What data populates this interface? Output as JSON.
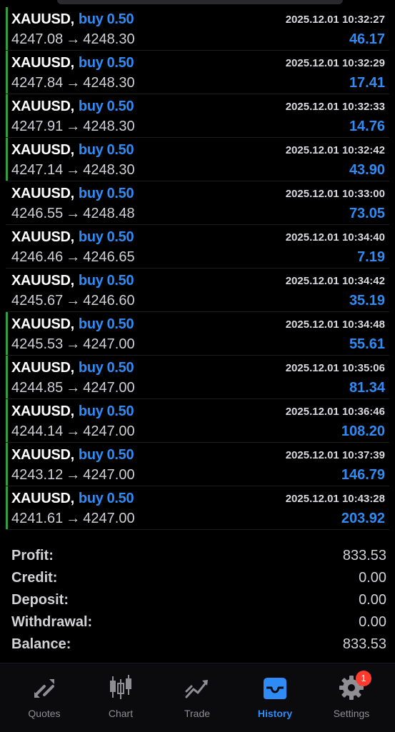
{
  "trades": [
    {
      "symbol": "XAUUSD",
      "side": "buy",
      "lots": "0.50",
      "time": "2025.12.01 10:32:27",
      "open": "4247.08",
      "close": "4248.30",
      "profit": "46.17",
      "marked": true
    },
    {
      "symbol": "XAUUSD",
      "side": "buy",
      "lots": "0.50",
      "time": "2025.12.01 10:32:29",
      "open": "4247.84",
      "close": "4248.30",
      "profit": "17.41",
      "marked": true
    },
    {
      "symbol": "XAUUSD",
      "side": "buy",
      "lots": "0.50",
      "time": "2025.12.01 10:32:33",
      "open": "4247.91",
      "close": "4248.30",
      "profit": "14.76",
      "marked": true
    },
    {
      "symbol": "XAUUSD",
      "side": "buy",
      "lots": "0.50",
      "time": "2025.12.01 10:32:42",
      "open": "4247.14",
      "close": "4248.30",
      "profit": "43.90",
      "marked": true
    },
    {
      "symbol": "XAUUSD",
      "side": "buy",
      "lots": "0.50",
      "time": "2025.12.01 10:33:00",
      "open": "4246.55",
      "close": "4248.48",
      "profit": "73.05",
      "marked": false
    },
    {
      "symbol": "XAUUSD",
      "side": "buy",
      "lots": "0.50",
      "time": "2025.12.01 10:34:40",
      "open": "4246.46",
      "close": "4246.65",
      "profit": "7.19",
      "marked": false
    },
    {
      "symbol": "XAUUSD",
      "side": "buy",
      "lots": "0.50",
      "time": "2025.12.01 10:34:42",
      "open": "4245.67",
      "close": "4246.60",
      "profit": "35.19",
      "marked": false
    },
    {
      "symbol": "XAUUSD",
      "side": "buy",
      "lots": "0.50",
      "time": "2025.12.01 10:34:48",
      "open": "4245.53",
      "close": "4247.00",
      "profit": "55.61",
      "marked": true
    },
    {
      "symbol": "XAUUSD",
      "side": "buy",
      "lots": "0.50",
      "time": "2025.12.01 10:35:06",
      "open": "4244.85",
      "close": "4247.00",
      "profit": "81.34",
      "marked": true
    },
    {
      "symbol": "XAUUSD",
      "side": "buy",
      "lots": "0.50",
      "time": "2025.12.01 10:36:46",
      "open": "4244.14",
      "close": "4247.00",
      "profit": "108.20",
      "marked": true
    },
    {
      "symbol": "XAUUSD",
      "side": "buy",
      "lots": "0.50",
      "time": "2025.12.01 10:37:39",
      "open": "4243.12",
      "close": "4247.00",
      "profit": "146.79",
      "marked": true
    },
    {
      "symbol": "XAUUSD",
      "side": "buy",
      "lots": "0.50",
      "time": "2025.12.01 10:43:28",
      "open": "4241.61",
      "close": "4247.00",
      "profit": "203.92",
      "marked": true
    }
  ],
  "summary": {
    "profit_label": "Profit:",
    "profit_value": "833.53",
    "credit_label": "Credit:",
    "credit_value": "0.00",
    "deposit_label": "Deposit:",
    "deposit_value": "0.00",
    "withdrawal_label": "Withdrawal:",
    "withdrawal_value": "0.00",
    "balance_label": "Balance:",
    "balance_value": "833.53"
  },
  "tabs": {
    "quotes": "Quotes",
    "chart": "Chart",
    "trade": "Trade",
    "history": "History",
    "settings": "Settings",
    "settings_badge": "1"
  },
  "colors": {
    "accent": "#2f8cf6",
    "marker": "#2ea043",
    "badge": "#ff3b30"
  }
}
